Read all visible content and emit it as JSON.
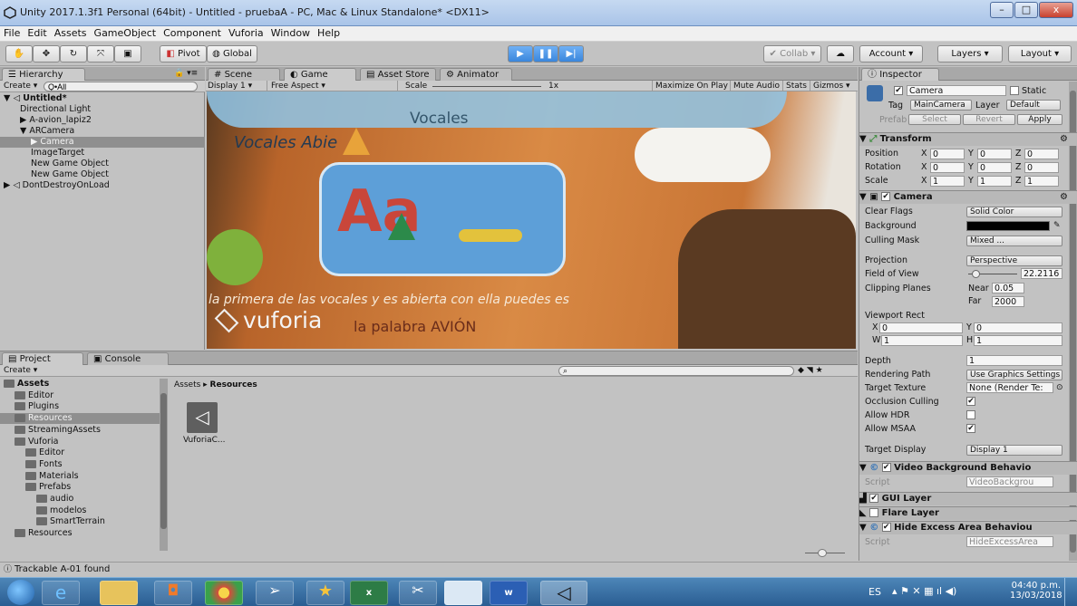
{
  "window": {
    "title": "Unity 2017.1.3f1 Personal (64bit) - Untitled - pruebaA - PC, Mac & Linux Standalone* <DX11>",
    "minimize": "–",
    "maximize": "□",
    "close": "x"
  },
  "menu": [
    "File",
    "Edit",
    "Assets",
    "GameObject",
    "Component",
    "Vuforia",
    "Window",
    "Help"
  ],
  "toolbar": {
    "pivot": "Pivot",
    "global": "Global",
    "collab": "Collab",
    "account": "Account",
    "layers": "Layers",
    "layout": "Layout"
  },
  "hierarchy": {
    "tab": "Hierarchy",
    "create": "Create",
    "search": "Q•All",
    "scene": "Untitled*",
    "items": [
      "Directional Light",
      "A-avion_lapiz2",
      "ARCamera",
      "Camera",
      "ImageTarget",
      "New Game Object",
      "New Game Object",
      "DontDestroyOnLoad"
    ]
  },
  "center_tabs": {
    "scene": "Scene",
    "game": "Game",
    "asset_store": "Asset Store",
    "animator": "Animator"
  },
  "game_bar": {
    "display": "Display 1",
    "aspect": "Free Aspect",
    "scale_label": "Scale",
    "scale_value": "1x",
    "maximize": "Maximize On Play",
    "mute": "Mute Audio",
    "stats": "Stats",
    "gizmos": "Gizmos"
  },
  "game_view": {
    "heading": "Vocales",
    "sub": "Vocales Abie",
    "letters": "Aa",
    "bottom_text": "la primera de las vocales y es abierta con ella puedes es",
    "brand": "vuforia",
    "brand_sub": "la palabra AVIÓN"
  },
  "project": {
    "tab_project": "Project",
    "tab_console": "Console",
    "create": "Create",
    "tree": [
      {
        "label": "Assets",
        "depth": 0,
        "bold": true
      },
      {
        "label": "Editor",
        "depth": 1
      },
      {
        "label": "Plugins",
        "depth": 1
      },
      {
        "label": "Resources",
        "depth": 1,
        "selected": true
      },
      {
        "label": "StreamingAssets",
        "depth": 1
      },
      {
        "label": "Vuforia",
        "depth": 1
      },
      {
        "label": "Editor",
        "depth": 2
      },
      {
        "label": "Fonts",
        "depth": 2
      },
      {
        "label": "Materials",
        "depth": 2
      },
      {
        "label": "Prefabs",
        "depth": 2
      },
      {
        "label": "audio",
        "depth": 3
      },
      {
        "label": "modelos",
        "depth": 3
      },
      {
        "label": "SmartTerrain",
        "depth": 3
      },
      {
        "label": "Resources",
        "depth": 1
      }
    ],
    "breadcrumb_root": "Assets",
    "breadcrumb_leaf": "Resources",
    "asset_label": "VuforiaC..."
  },
  "status": "Trackable A-01 found",
  "inspector": {
    "tab": "Inspector",
    "name": "Camera",
    "static": "Static",
    "tag_label": "Tag",
    "tag": "MainCamera",
    "layer_label": "Layer",
    "layer": "Default",
    "prefab": "Prefab",
    "select": "Select",
    "revert": "Revert",
    "apply": "Apply",
    "transform": {
      "title": "Transform",
      "position": [
        "0",
        "0",
        "0"
      ],
      "rotation": [
        "0",
        "0",
        "0"
      ],
      "scale": [
        "1",
        "1",
        "1"
      ],
      "labels": [
        "Position",
        "Rotation",
        "Scale"
      ]
    },
    "camera": {
      "title": "Camera",
      "clear_flags_label": "Clear Flags",
      "clear_flags": "Solid Color",
      "background_label": "Background",
      "culling_label": "Culling Mask",
      "culling": "Mixed ...",
      "projection_label": "Projection",
      "projection": "Perspective",
      "fov_label": "Field of View",
      "fov": "22.2116",
      "fov_fraction": 0.15,
      "clipping_label": "Clipping Planes",
      "near_label": "Near",
      "near": "0.05",
      "far_label": "Far",
      "far": "2000",
      "viewport_label": "Viewport Rect",
      "vx": "0",
      "vy": "0",
      "vw": "1",
      "vh": "1",
      "depth_label": "Depth",
      "depth": "1",
      "rendering_label": "Rendering Path",
      "rendering": "Use Graphics Settings",
      "target_texture_label": "Target Texture",
      "target_texture": "None (Render Te:",
      "occlusion_label": "Occlusion Culling",
      "hdr_label": "Allow HDR",
      "msaa_label": "Allow MSAA",
      "display_label": "Target Display",
      "display": "Display 1"
    },
    "video_bg": {
      "title": "Video Background Behavio",
      "script_label": "Script",
      "script": "VideoBackgrou"
    },
    "gui_layer": "GUI Layer",
    "flare_layer": "Flare Layer",
    "hide_excess": {
      "title": "Hide Excess Area Behaviou",
      "script_label": "Script",
      "script": "HideExcessArea"
    }
  },
  "taskbar": {
    "lang": "ES",
    "time": "04:40 p.m.",
    "date": "13/03/2018"
  },
  "colors": {
    "accent": "#3a86dc",
    "selection": "#8f8f8f",
    "game_bg": "#c46e2a"
  }
}
